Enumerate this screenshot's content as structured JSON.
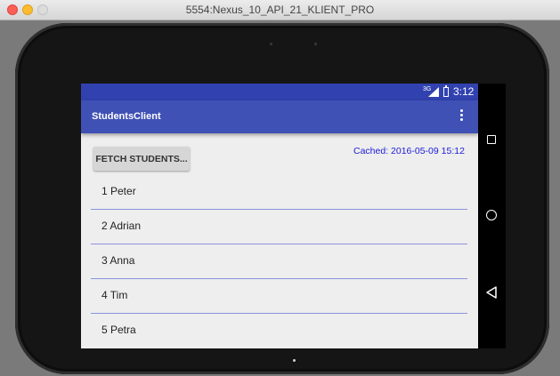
{
  "window": {
    "title": "5554:Nexus_10_API_21_KLIENT_PRO"
  },
  "status_bar": {
    "network": "3G",
    "time": "3:12"
  },
  "app_bar": {
    "title": "StudentsClient"
  },
  "content": {
    "fetch_button_label": "FETCH STUDENTS...",
    "cached_text": "Cached: 2016-05-09 15:12",
    "students": [
      {
        "label": "1 Peter"
      },
      {
        "label": "2 Adrian"
      },
      {
        "label": "3 Anna"
      },
      {
        "label": "4 Tim"
      },
      {
        "label": "5 Petra"
      }
    ]
  },
  "icons": {
    "overflow": "more-vert-icon",
    "nav_square": "square-icon",
    "nav_circle": "circle-icon",
    "nav_triangle": "triangle-back-icon"
  },
  "colors": {
    "app_bar": "#3f51b5",
    "status_bar": "#3142b0",
    "cached_text": "#1b1bd6",
    "divider": "#8a94dc"
  }
}
